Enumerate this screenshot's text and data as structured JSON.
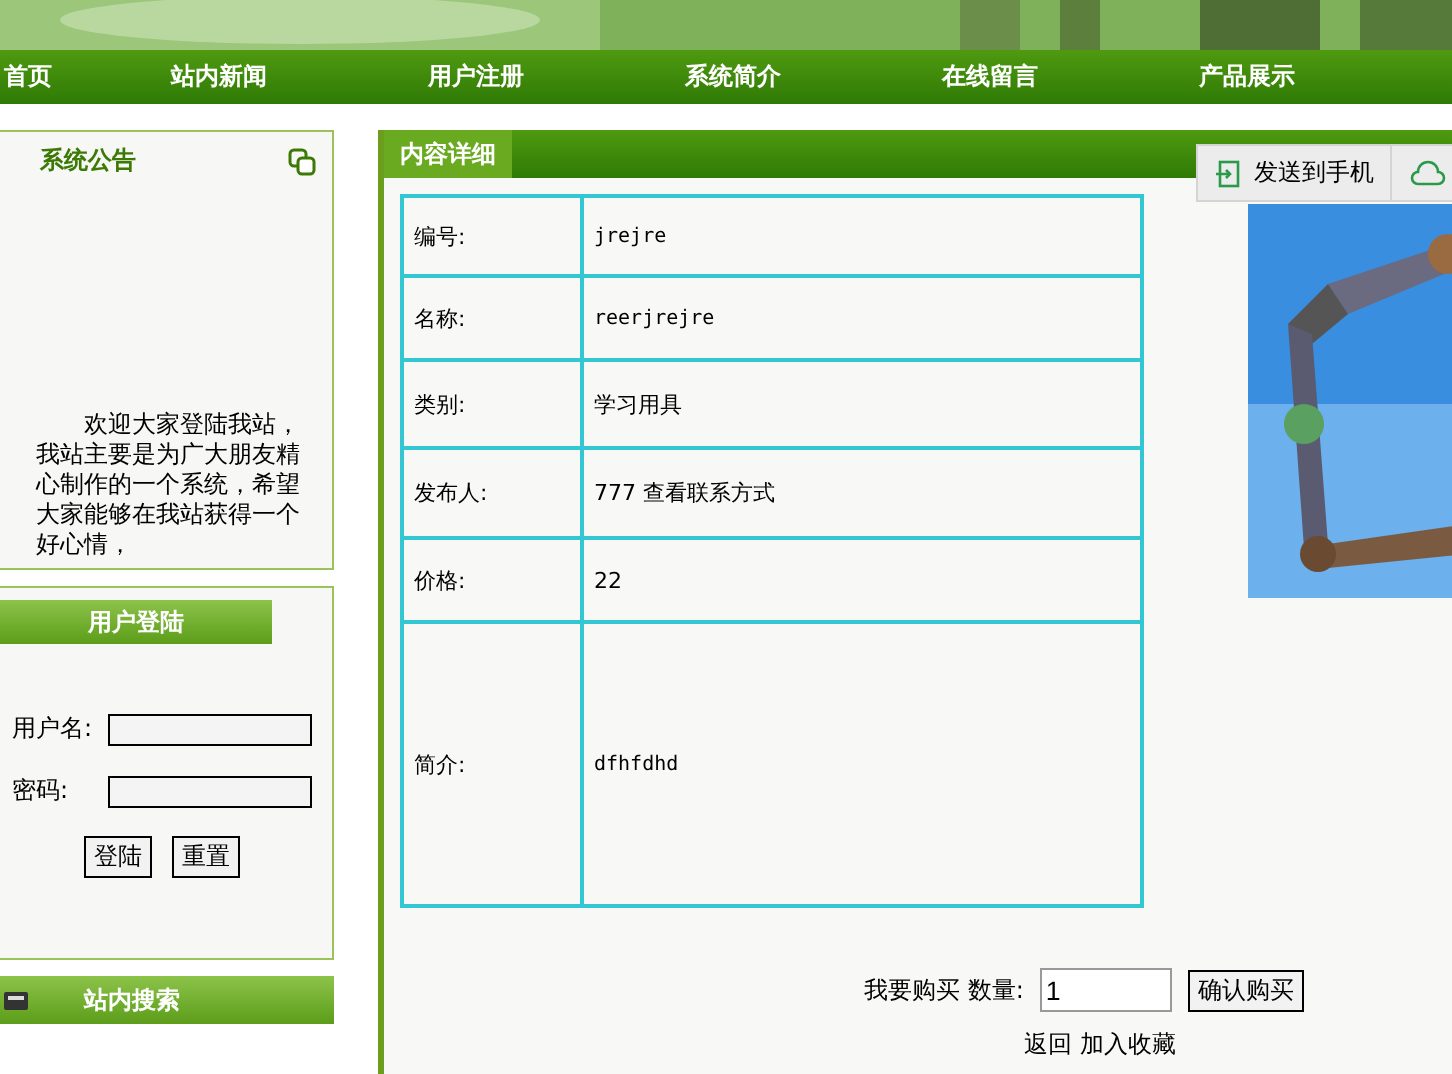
{
  "nav": [
    {
      "label": "首页",
      "selected": false
    },
    {
      "label": "站内新闻",
      "selected": false
    },
    {
      "label": "用户注册",
      "selected": false
    },
    {
      "label": "系统简介",
      "selected": false
    },
    {
      "label": "在线留言",
      "selected": false
    },
    {
      "label": "产品展示",
      "selected": false
    }
  ],
  "notice": {
    "title": "系统公告",
    "text": "欢迎大家登陆我站，我站主要是为广大朋友精心制作的一个系统，希望大家能够在我站获得一个好心情，"
  },
  "login": {
    "title": "用户登陆",
    "fields": [
      {
        "label": "用户名:"
      },
      {
        "label": "密码:"
      }
    ],
    "buttons": [
      "登陆",
      "重置"
    ]
  },
  "search": {
    "title": "站内搜索"
  },
  "detail": {
    "title": "内容详细",
    "rows": [
      {
        "label": "编号:",
        "value": "jrejre",
        "kind": "mono"
      },
      {
        "label": "名称:",
        "value": "reerjrejre",
        "kind": "mono"
      },
      {
        "label": "类别:",
        "value": "学习用具",
        "kind": "plain"
      },
      {
        "label": "发布人:",
        "value": "777 查看联系方式",
        "kind": "plain"
      },
      {
        "label": "价格:",
        "value": "22",
        "kind": "plain"
      },
      {
        "label": "简介:",
        "value": "dfhfdhd",
        "kind": "mono"
      }
    ],
    "buy": {
      "label": "我要购买 数量:",
      "quantity": "1",
      "button": "确认购买"
    },
    "links": [
      "返回",
      "加入收藏"
    ]
  },
  "toolbar": {
    "send": "发送到手机"
  }
}
